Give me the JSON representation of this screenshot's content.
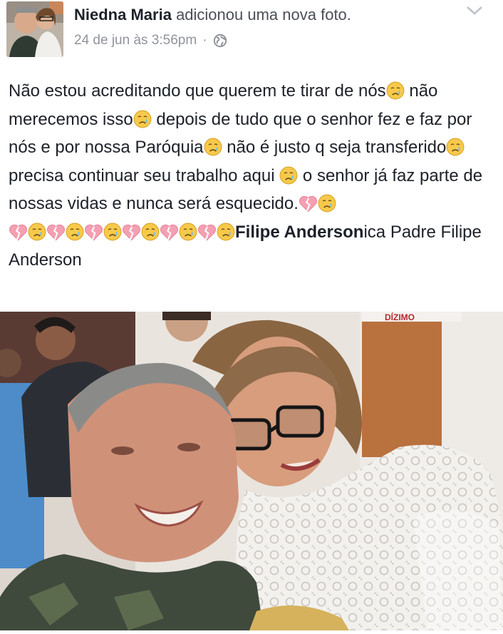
{
  "post": {
    "author": "Niedna Maria",
    "action": "adicionou uma nova foto.",
    "timestamp": "24 de jun às 3:56pm",
    "separator": "·",
    "privacy_icon": "globe-icon",
    "menu_icon": "chevron-down-icon",
    "avatar_icon": "profile-photo",
    "text": {
      "s1": "Não estou acreditando que querem te tirar de nós",
      "s2": "não merecemos isso",
      "s3": "depois de tudo que o senhor fez e faz por nós e por nossa Paróquia",
      "s4": "não é justo q seja transferido",
      "s5": "precisa continuar seu trabalho aqui",
      "s6": "o senhor já faz parte de nossas vidas e nunca será esquecido.",
      "tag": "Filipe Anderson",
      "s7": "ica Padre Filipe Anderson"
    },
    "emoji_icons": [
      "crying-face-icon",
      "broken-heart-icon"
    ],
    "photo_sign_text": "DÍZIMO"
  },
  "colors": {
    "name": "#1d2129",
    "secondary": "#90949c",
    "heart": "#f4a0b2",
    "emoji": "#f7c94a"
  }
}
